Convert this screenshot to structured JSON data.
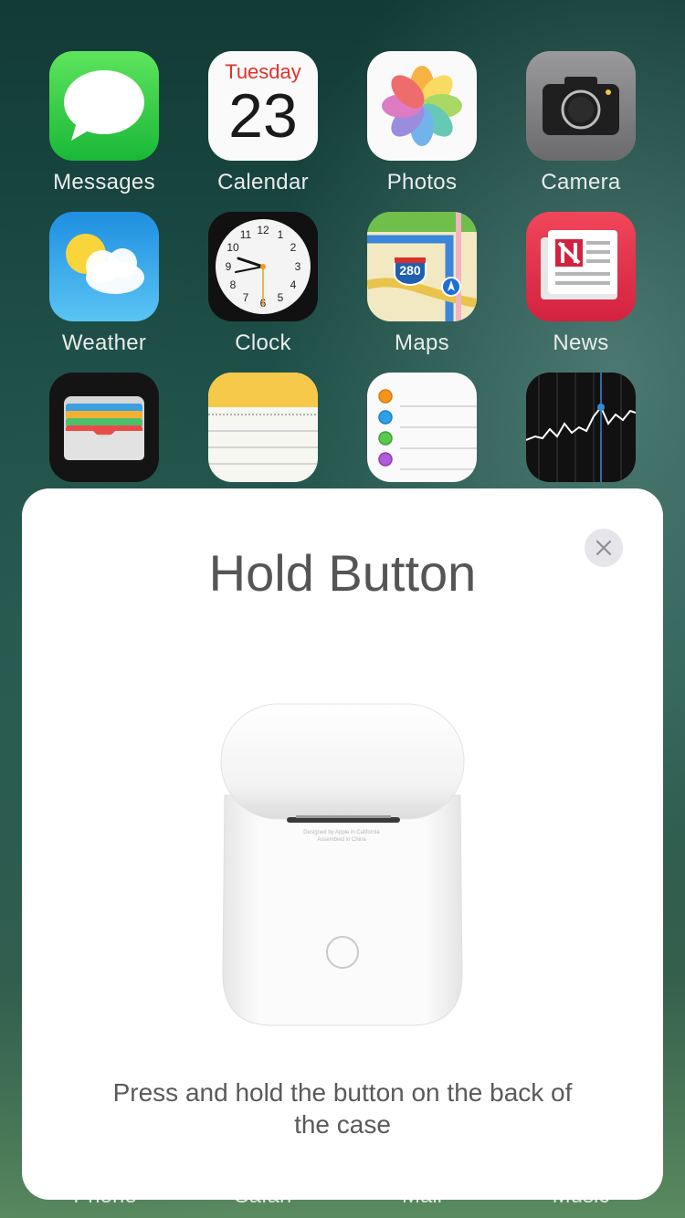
{
  "apps": {
    "messages": "Messages",
    "calendar": "Calendar",
    "photos": "Photos",
    "camera": "Camera",
    "weather": "Weather",
    "clock": "Clock",
    "maps": "Maps",
    "news": "News"
  },
  "calendar_icon": {
    "day": "Tuesday",
    "date": "23"
  },
  "maps_icon": {
    "shield": "280"
  },
  "clock_icon": {
    "numbers": [
      "12",
      "1",
      "2",
      "3",
      "4",
      "5",
      "6",
      "7",
      "8",
      "9",
      "10",
      "11"
    ]
  },
  "dock": {
    "phone": "Phone",
    "safari": "Safari",
    "mail": "Mail",
    "music": "Music"
  },
  "sheet": {
    "title": "Hold Button",
    "description": "Press and hold the button on the back of the case",
    "case_text_1": "Designed by Apple in California",
    "case_text_2": "Assembled in China"
  },
  "colors": {
    "messages": "#1ab838",
    "news": "#d32240",
    "calendar_day": "#e0322c",
    "sheet_bg": "#ffffff"
  }
}
